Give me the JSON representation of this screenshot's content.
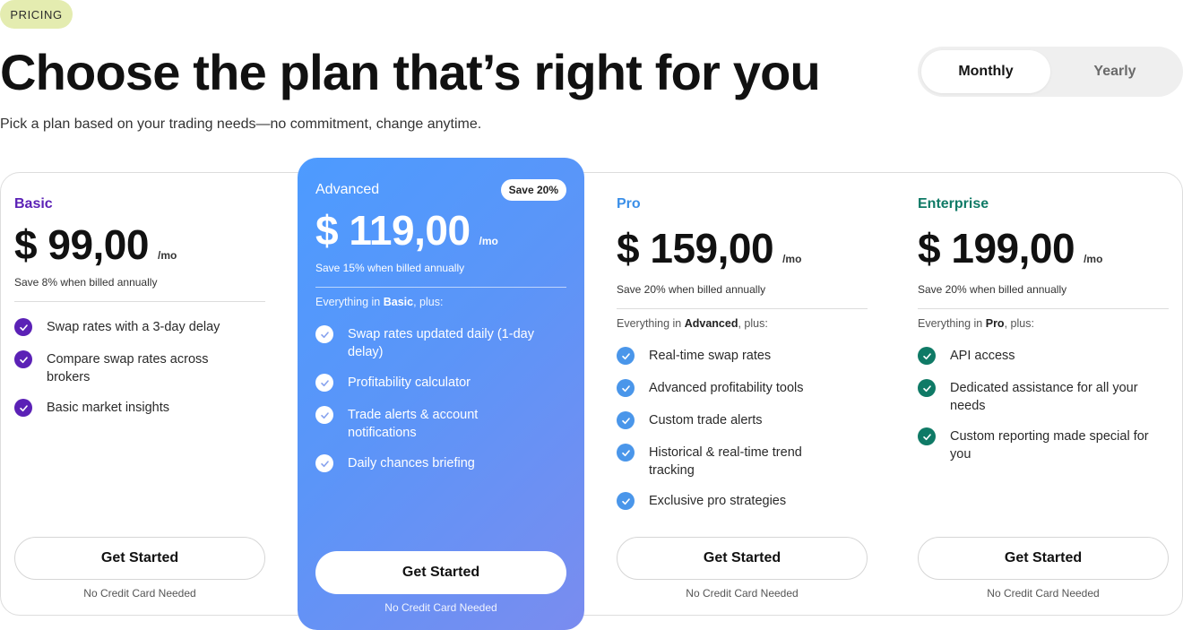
{
  "tag": "PRICING",
  "headline": "Choose the plan that’s right for you",
  "subline": "Pick a plan based on your trading needs—no commitment, change anytime.",
  "billing_toggle": {
    "options": [
      "Monthly",
      "Yearly"
    ],
    "selected": "Monthly"
  },
  "plans": [
    {
      "name": "Basic",
      "name_color": "#5b21b6",
      "price": "$ 99,00",
      "per": "/mo",
      "save_note": "Save 8% when billed annually",
      "features": [
        "Swap rates with a 3-day delay",
        "Compare swap rates across brokers",
        "Basic market insights"
      ],
      "check_color": "#5b21b6",
      "cta": "Get Started",
      "cta_note": "No Credit Card Needed"
    },
    {
      "name": "Advanced",
      "badge": "Save 20%",
      "price": "$ 119,00",
      "per": "/mo",
      "save_note": "Save 15% when billed annually",
      "inherit_prefix": "Everything in ",
      "inherit_plan": "Basic",
      "inherit_suffix": ", plus:",
      "features": [
        "Swap rates updated daily (1-day delay)",
        "Profitability calculator",
        "Trade alerts & account notifications",
        "Daily chances briefing"
      ],
      "check_color": "#ffffff",
      "cta": "Get Started",
      "cta_note": "No Credit Card Needed"
    },
    {
      "name": "Pro",
      "name_color": "#3b8fe8",
      "price": "$ 159,00",
      "per": "/mo",
      "save_note": "Save 20% when billed annually",
      "inherit_prefix": "Everything in ",
      "inherit_plan": "Advanced",
      "inherit_suffix": ", plus:",
      "features": [
        "Real-time swap rates",
        "Advanced profitability tools",
        "Custom trade alerts",
        "Historical & real-time trend tracking",
        "Exclusive pro strategies"
      ],
      "check_color": "#4a96ea",
      "cta": "Get Started",
      "cta_note": "No Credit Card Needed"
    },
    {
      "name": "Enterprise",
      "name_color": "#0f7a66",
      "price": "$ 199,00",
      "per": "/mo",
      "save_note": "Save 20% when billed annually",
      "inherit_prefix": "Everything in ",
      "inherit_plan": "Pro",
      "inherit_suffix": ", plus:",
      "features": [
        "API access",
        "Dedicated assistance for all your needs",
        "Custom reporting made special for you"
      ],
      "check_color": "#0f7a66",
      "cta": "Get Started",
      "cta_note": "No Credit Card Needed"
    }
  ]
}
